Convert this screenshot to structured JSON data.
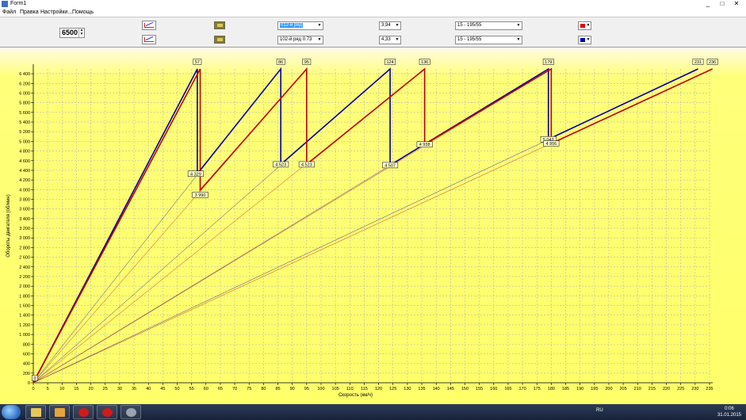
{
  "window": {
    "title": "Form1",
    "controls": [
      "_",
      "□",
      "✕"
    ]
  },
  "menu": [
    "Файл",
    "Правка",
    "Настройки...",
    "Помощь"
  ],
  "toolbar": {
    "rpm_value": "6500",
    "rows": [
      {
        "gearbox": "012-й ряд",
        "main_pair": "3,94",
        "tyre": "15 - 195/55",
        "color": "#e00000",
        "selected": true
      },
      {
        "gearbox": "102-й ряд 0.73",
        "main_pair": "4,33",
        "tyre": "15 - 195/55",
        "color": "#0000c0",
        "selected": false
      }
    ]
  },
  "chart_data": {
    "type": "line",
    "xlabel": "Скорость (км/ч)",
    "ylabel": "Обороты двигателя (об/мин)",
    "xlim": [
      0,
      235
    ],
    "ylim": [
      0,
      6500
    ],
    "x_ticks": [
      0,
      5,
      10,
      15,
      20,
      25,
      30,
      35,
      40,
      45,
      50,
      55,
      60,
      65,
      70,
      75,
      80,
      85,
      90,
      95,
      100,
      105,
      110,
      115,
      120,
      125,
      130,
      135,
      140,
      145,
      150,
      155,
      160,
      165,
      170,
      175,
      180,
      185,
      190,
      195,
      200,
      205,
      210,
      215,
      220,
      225,
      230,
      235
    ],
    "y_ticks": [
      0,
      200,
      400,
      600,
      800,
      1000,
      1200,
      1400,
      1600,
      1800,
      2000,
      2200,
      2400,
      2600,
      2800,
      3000,
      3200,
      3400,
      3600,
      3800,
      4000,
      4200,
      4400,
      4600,
      4800,
      5000,
      5200,
      5400,
      5600,
      5800,
      6000,
      6200,
      6400
    ],
    "grid": true,
    "series": [
      {
        "color": "#0000a0",
        "gear_speeds_at_max": [
          57,
          86,
          124,
          179,
          231
        ],
        "shift_points": [
          {
            "speed": 57,
            "rpm_after": 4329
          },
          {
            "speed": 86,
            "rpm_after": 4523
          },
          {
            "speed": 124,
            "rpm_after": 4507
          },
          {
            "speed": 179,
            "rpm_after": 5043
          }
        ],
        "max_rpm": 6500
      },
      {
        "color": "#c00000",
        "gear_speeds_at_max": [
          58,
          95,
          136,
          180,
          236
        ],
        "shift_points": [
          {
            "speed": 58,
            "rpm_after": 3990
          },
          {
            "speed": 95,
            "rpm_after": 4523
          },
          {
            "speed": 136,
            "rpm_after": 4938
          },
          {
            "speed": 180,
            "rpm_after": 4956
          }
        ],
        "max_rpm": 6500
      }
    ],
    "top_labels": [
      "57",
      "86",
      "95",
      "124",
      "136",
      "179",
      "231",
      "236"
    ],
    "shift_labels": [
      "4 329",
      "3 990",
      "4 523",
      "4 523",
      "4 507",
      "4 938",
      "5 043",
      "4 956"
    ],
    "origin_label": "0"
  },
  "taskbar": {
    "apps": [
      "folder",
      "media",
      "opera",
      "opera",
      "settings"
    ],
    "lang": "RU",
    "time": "0:06",
    "date": "31.01.2015"
  }
}
